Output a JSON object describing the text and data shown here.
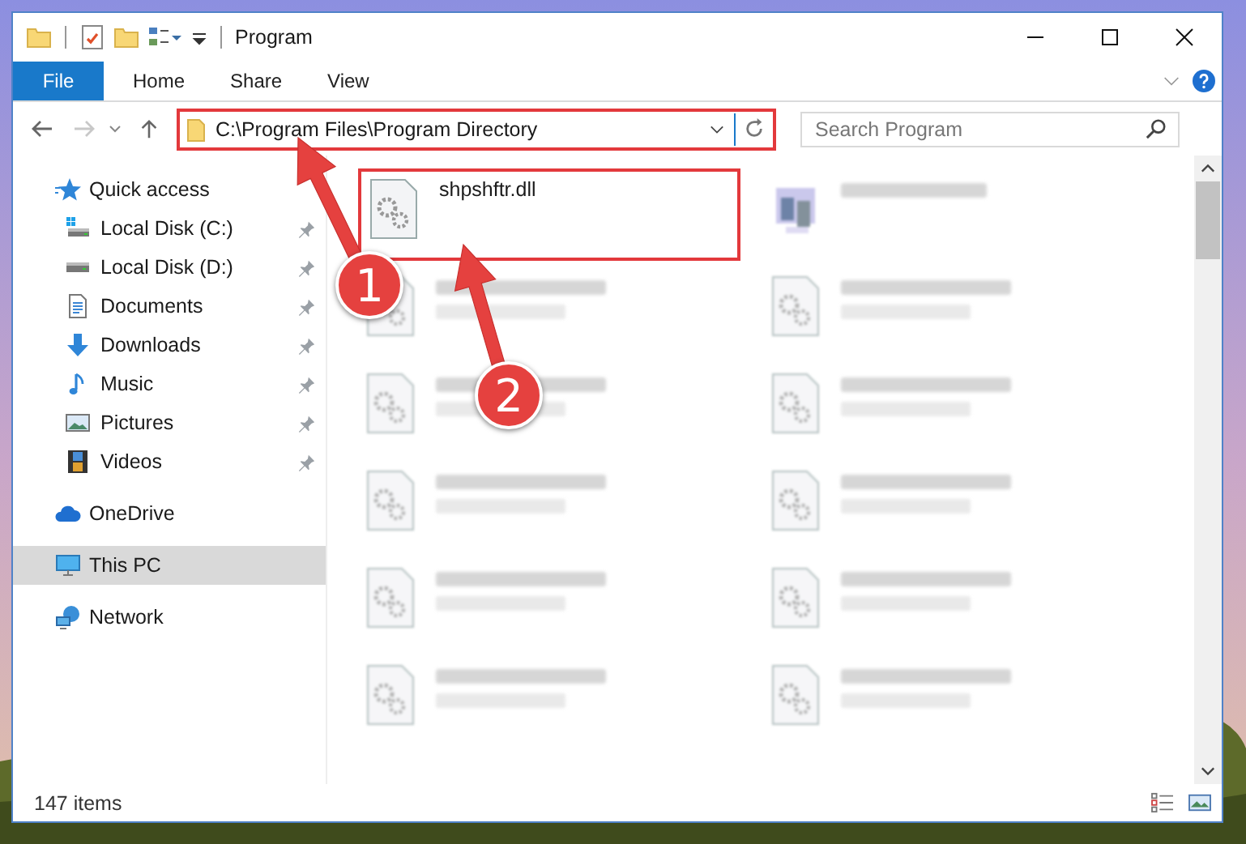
{
  "window": {
    "title": "Program"
  },
  "ribbon_tabs": [
    {
      "label": "File",
      "selected": true
    },
    {
      "label": "Home",
      "selected": false
    },
    {
      "label": "Share",
      "selected": false
    },
    {
      "label": "View",
      "selected": false
    }
  ],
  "navigation": {
    "forward_disabled": true
  },
  "address": {
    "path": "C:\\Program Files\\Program Directory",
    "highlighted": true
  },
  "search": {
    "placeholder": "Search Program"
  },
  "sidebar": {
    "items": [
      {
        "label": "Quick access",
        "kind": "quick-access",
        "selected": false,
        "children": [
          {
            "label": "Local Disk (C:)",
            "kind": "system-drive",
            "pinned": true,
            "selected": false
          },
          {
            "label": "Local Disk (D:)",
            "kind": "drive",
            "pinned": true,
            "selected": false
          },
          {
            "label": "Documents",
            "kind": "documents",
            "pinned": true,
            "selected": false
          },
          {
            "label": "Downloads",
            "kind": "downloads",
            "pinned": true,
            "selected": false
          },
          {
            "label": "Music",
            "kind": "music",
            "pinned": true,
            "selected": false
          },
          {
            "label": "Pictures",
            "kind": "pictures",
            "pinned": true,
            "selected": false
          },
          {
            "label": "Videos",
            "kind": "videos",
            "pinned": true,
            "selected": false
          }
        ]
      },
      {
        "label": "OneDrive",
        "kind": "cloud",
        "selected": false
      },
      {
        "label": "This PC",
        "kind": "computer",
        "selected": true
      },
      {
        "label": "Network",
        "kind": "network",
        "selected": false
      }
    ]
  },
  "files": [
    {
      "name": "shpshftr.dll",
      "kind": "dll",
      "highlighted": true,
      "blurred": false
    },
    {
      "kind": "exe",
      "highlighted": false,
      "blurred": true
    },
    {
      "kind": "dll",
      "highlighted": false,
      "blurred": true
    },
    {
      "kind": "dll",
      "highlighted": false,
      "blurred": true
    },
    {
      "kind": "dll",
      "highlighted": false,
      "blurred": true
    },
    {
      "kind": "dll",
      "highlighted": false,
      "blurred": true
    },
    {
      "kind": "dll",
      "highlighted": false,
      "blurred": true
    },
    {
      "kind": "dll",
      "highlighted": false,
      "blurred": true
    },
    {
      "kind": "dll",
      "highlighted": false,
      "blurred": true
    },
    {
      "kind": "dll",
      "highlighted": false,
      "blurred": true
    },
    {
      "kind": "dll",
      "highlighted": false,
      "blurred": true
    },
    {
      "kind": "dll",
      "highlighted": false,
      "blurred": true
    }
  ],
  "annotations": [
    {
      "number": "1"
    },
    {
      "number": "2"
    }
  ],
  "status_bar": {
    "item_count": "147 items"
  }
}
